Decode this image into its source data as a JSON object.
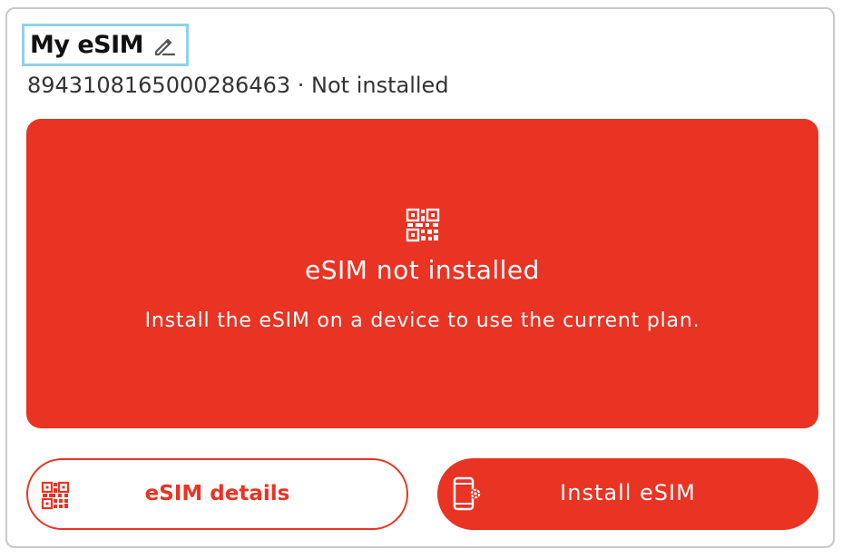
{
  "header": {
    "title": "My eSIM",
    "edit_icon": "pencil-icon"
  },
  "esim": {
    "iccid": "8943108165000286463",
    "separator": "·",
    "status": "Not installed"
  },
  "banner": {
    "icon": "qr-code-icon",
    "title": "eSIM not installed",
    "description": "Install the eSIM on a device to use the current plan.",
    "background_color": "#e93323"
  },
  "actions": {
    "details_label": "eSIM details",
    "details_icon": "qr-code-icon",
    "install_label": "Install eSIM",
    "install_icon": "phone-settings-icon"
  },
  "colors": {
    "accent": "#e93323",
    "focus_outline": "#8fd1ef"
  }
}
